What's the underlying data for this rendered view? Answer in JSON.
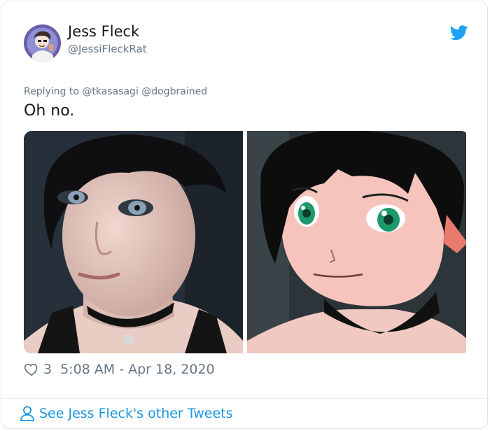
{
  "author": {
    "name": "Jess Fleck",
    "handle": "@JessiFleckRat"
  },
  "reply_context": "Replying to @tkasasagi @dogbrained",
  "tweet_text": "Oh no.",
  "likes": "3",
  "timestamp": "5:08 AM - Apr 18, 2020",
  "footer_link": "See Jess Fleck's other Tweets",
  "colors": {
    "twitter_blue": "#1da1f2",
    "link_blue": "#1b95e0",
    "secondary_text": "#657786",
    "primary_text": "#14171a"
  },
  "icons": [
    "avatar",
    "twitter-bird-icon",
    "heart-icon",
    "person-icon"
  ]
}
